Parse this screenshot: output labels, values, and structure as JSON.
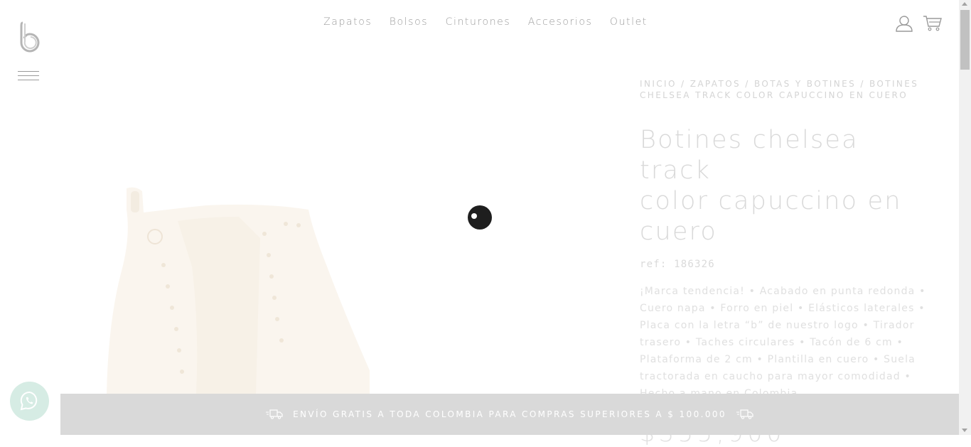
{
  "brand": {
    "logo_icon": "b-logo-icon"
  },
  "nav": {
    "items": [
      "Zapatos",
      "Bolsos",
      "Cinturones",
      "Accesorios",
      "Outlet"
    ]
  },
  "header_icons": [
    "user-icon",
    "cart-icon"
  ],
  "breadcrumb": {
    "items": [
      "INICIO",
      "ZAPATOS",
      "BOTAS Y BOTINES",
      "BOTINES CHELSEA TRACK COLOR CAPUCCINO EN CUERO"
    ],
    "separator": " / "
  },
  "product": {
    "title_lines": [
      "Botines chelsea track",
      "color capuccino en",
      "cuero"
    ],
    "ref": "ref: 186326",
    "description": "¡Marca tendencia! • Acabado en punta redonda • Cuero napa • Forro en piel • Elásticos laterales • Placa con la letra “b” de nuestro logo • Tirador trasero • Taches circulares • Tacón de 6 cm • Plataforma de 2 cm • Plantilla en cuero • Suela tractorada en caucho para mayor comodidad • Hecho a mano en Colombia",
    "price": "$355,900"
  },
  "shipping_bar": {
    "text": "ENVÍO GRATIS A TODA COLOMBIA PARA COMPRAS SUPERIORES A $ 100.000"
  },
  "colors": {
    "nav_text": "#9c9c9c",
    "faded_text": "#d9d9d9",
    "shipbar_bg": "#d9d9d9",
    "whatsapp_bg": "#d6ece4"
  }
}
